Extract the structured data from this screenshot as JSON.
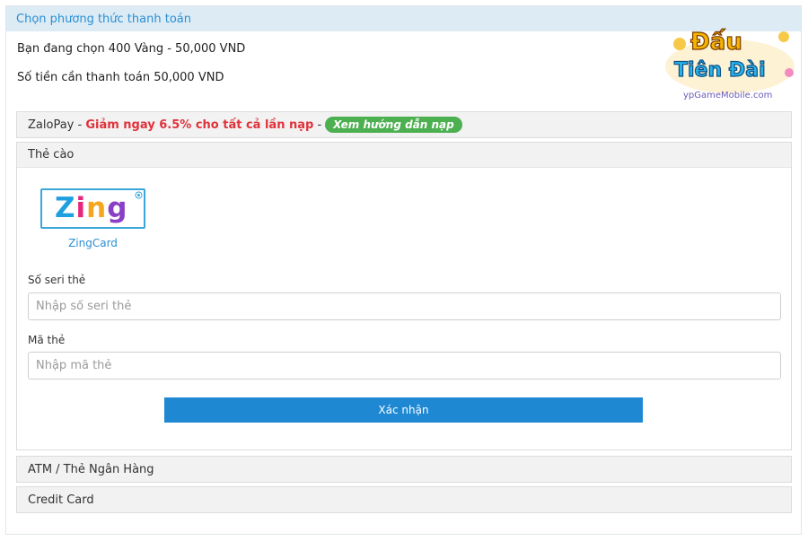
{
  "header": {
    "title": "Chọn phương thức thanh toán"
  },
  "order": {
    "selected_text": "Bạn đang chọn 400 Vàng - 50,000 VND",
    "amount_text": "Số tiền cần thanh toán 50,000 VND"
  },
  "logo": {
    "line1": "Đấu",
    "line2": "Tiên Đài",
    "site": "ypGameMobile.com"
  },
  "zalopay": {
    "name": "ZaloPay",
    "sep": " - ",
    "promo": "Giảm ngay 6.5% cho tất cả lần nạp",
    "sep2": " -",
    "guide_label": "Xem hướng dẫn nạp"
  },
  "card": {
    "header": "Thẻ cào",
    "provider_logo_text": "Zing",
    "provider_name": "ZingCard",
    "serial_label": "Số seri thẻ",
    "serial_placeholder": "Nhập số seri thẻ",
    "pin_label": "Mã thẻ",
    "pin_placeholder": "Nhập mã thẻ",
    "submit_label": "Xác nhận"
  },
  "other_methods": [
    {
      "label": "ATM / Thẻ Ngân Hàng"
    },
    {
      "label": "Credit Card"
    }
  ],
  "colors": {
    "accent": "#1e88d3",
    "header_bg": "#dcebf4",
    "promo_red": "#e0323a",
    "guide_green": "#4caf50",
    "zing_z": "#1ea0e0",
    "zing_i": "#e6287d",
    "zing_n": "#f4a61d",
    "zing_g": "#8a3fc6"
  }
}
